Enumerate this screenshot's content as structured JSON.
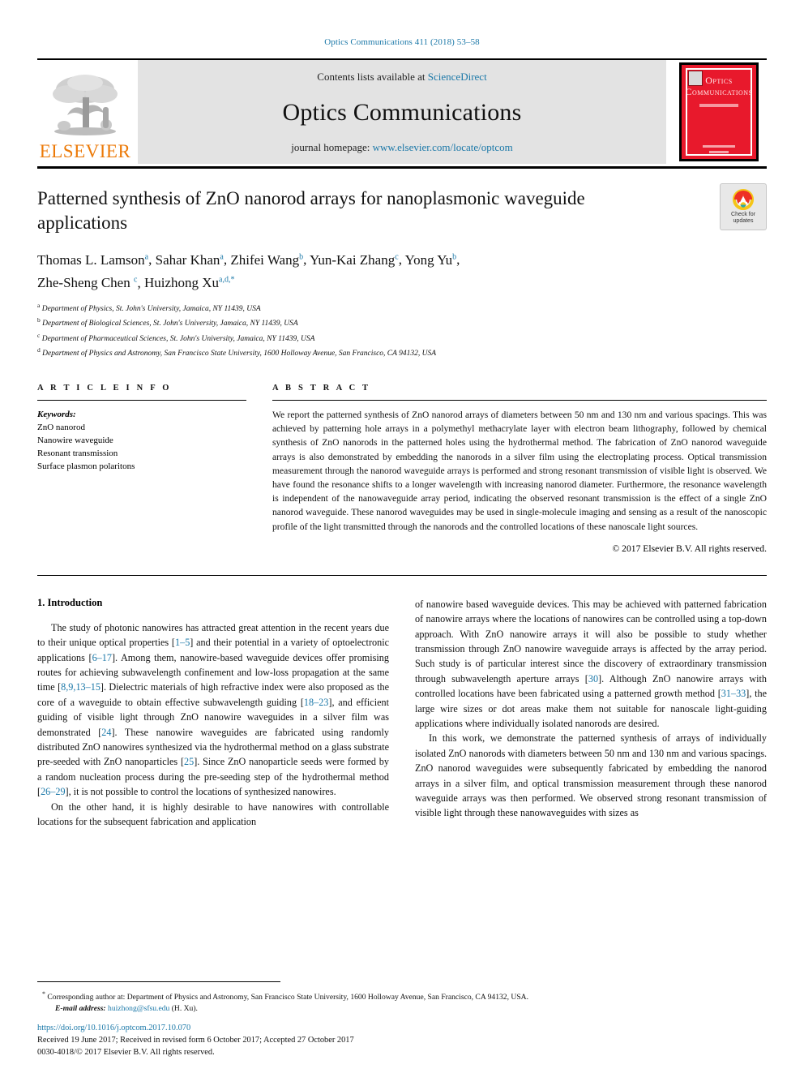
{
  "running_head": "Optics Communications 411 (2018) 53–58",
  "masthead": {
    "publisher_name": "ELSEVIER",
    "contents_prefix": "Contents lists available at ",
    "contents_link": "ScienceDirect",
    "journal_title": "Optics Communications",
    "homepage_prefix": "journal homepage: ",
    "homepage_link": "www.elsevier.com/locate/optcom",
    "cover_title_line1": "Optics",
    "cover_title_line2": "Communications"
  },
  "article": {
    "title": "Patterned synthesis of ZnO nanorod arrays for nanoplasmonic waveguide applications",
    "crossmark_label_line1": "Check for",
    "crossmark_label_line2": "updates",
    "authors_line1": [
      {
        "name": "Thomas L. Lamson",
        "sup": "a"
      },
      {
        "name": "Sahar Khan",
        "sup": "a"
      },
      {
        "name": "Zhifei Wang",
        "sup": "b"
      },
      {
        "name": "Yun-Kai Zhang",
        "sup": "c"
      },
      {
        "name": "Yong Yu",
        "sup": "b"
      }
    ],
    "authors_line2": [
      {
        "name": "Zhe-Sheng Chen",
        "sup": "c"
      },
      {
        "name": "Huizhong Xu",
        "sup": "a,d,*"
      }
    ],
    "affiliations": [
      {
        "mark": "a",
        "text": "Department of Physics, St. John's University, Jamaica, NY 11439, USA"
      },
      {
        "mark": "b",
        "text": "Department of Biological Sciences, St. John's University, Jamaica, NY 11439, USA"
      },
      {
        "mark": "c",
        "text": "Department of Pharmaceutical Sciences, St. John's University, Jamaica, NY 11439, USA"
      },
      {
        "mark": "d",
        "text": "Department of Physics and Astronomy, San Francisco State University, 1600 Holloway Avenue, San Francisco, CA 94132, USA"
      }
    ]
  },
  "article_info": {
    "heading": "A R T I C L E   I N F O",
    "keywords_label": "Keywords:",
    "keywords": [
      "ZnO nanorod",
      "Nanowire waveguide",
      "Resonant transmission",
      "Surface plasmon polaritons"
    ]
  },
  "abstract": {
    "heading": "A B S T R A C T",
    "text": "We report the patterned synthesis of ZnO nanorod arrays of diameters between 50 nm and 130 nm and various spacings. This was achieved by patterning hole arrays in a polymethyl methacrylate layer with electron beam lithography, followed by chemical synthesis of ZnO nanorods in the patterned holes using the hydrothermal method. The fabrication of ZnO nanorod waveguide arrays is also demonstrated by embedding the nanorods in a silver film using the electroplating process. Optical transmission measurement through the nanorod waveguide arrays is performed and strong resonant transmission of visible light is observed. We have found the resonance shifts to a longer wavelength with increasing nanorod diameter. Furthermore, the resonance wavelength is independent of the nanowaveguide array period, indicating the observed resonant transmission is the effect of a single ZnO nanorod waveguide. These nanorod waveguides may be used in single-molecule imaging and sensing as a result of the nanoscopic profile of the light transmitted through the nanorods and the controlled locations of these nanoscale light sources.",
    "copyright": "© 2017 Elsevier B.V. All rights reserved."
  },
  "body": {
    "section_title": "1.  Introduction",
    "left_paragraphs": [
      "The study of photonic nanowires has attracted great attention in the recent years due to their unique optical properties [1–5] and their potential in a variety of optoelectronic applications [6–17]. Among them, nanowire-based waveguide devices offer promising routes for achieving subwavelength confinement and low-loss propagation at the same time [8,9,13–15]. Dielectric materials of high refractive index were also proposed as the core of a waveguide to obtain effective subwavelength guiding [18–23], and efficient guiding of visible light through ZnO nanowire waveguides in a silver film was demonstrated [24]. These nanowire waveguides are fabricated using randomly distributed ZnO nanowires synthesized via the hydrothermal method on a glass substrate pre-seeded with ZnO nanoparticles [25]. Since ZnO nanoparticle seeds were formed by a random nucleation process during the pre-seeding step of the hydrothermal method [26–29], it is not possible to control the locations of synthesized nanowires.",
      "On the other hand, it is highly desirable to have nanowires with controllable locations for the subsequent fabrication and application"
    ],
    "right_paragraphs": [
      "of nanowire based waveguide devices. This may be achieved with patterned fabrication of nanowire arrays where the locations of nanowires can be controlled using a top-down approach. With ZnO nanowire arrays it will also be possible to study whether transmission through ZnO nanowire waveguide arrays is affected by the array period. Such study is of particular interest since the discovery of extraordinary transmission through subwavelength aperture arrays [30]. Although ZnO nanowire arrays with controlled locations have been fabricated using a patterned growth method [31–33], the large wire sizes or dot areas make them not suitable for nanoscale light-guiding applications where individually isolated nanorods are desired.",
      "In this work, we demonstrate the patterned synthesis of arrays of individually isolated ZnO nanorods with diameters between 50 nm and 130 nm and various spacings. ZnO nanorod waveguides were subsequently fabricated by embedding the nanorod arrays in a silver film, and optical transmission measurement through these nanorod waveguide arrays was then performed. We observed strong resonant transmission of visible light through these nanowaveguides with sizes as"
    ]
  },
  "footer": {
    "corresponding_marker": "*",
    "corresponding_text": "Corresponding author at: Department of Physics and Astronomy, San Francisco State University, 1600 Holloway Avenue, San Francisco, CA 94132, USA.",
    "email_label": "E-mail address:",
    "email": "huizhong@sfsu.edu",
    "email_suffix": "(H. Xu).",
    "doi": "https://doi.org/10.1016/j.optcom.2017.10.070",
    "received": "Received 19 June 2017; Received in revised form 6 October 2017; Accepted 27 October 2017",
    "issn": "0030-4018/© 2017 Elsevier B.V. All rights reserved."
  },
  "colors": {
    "link": "#1b78a8",
    "elsevier_orange": "#EC7A08",
    "cover_red": "#e8192c",
    "band_gray": "#e3e3e3"
  }
}
